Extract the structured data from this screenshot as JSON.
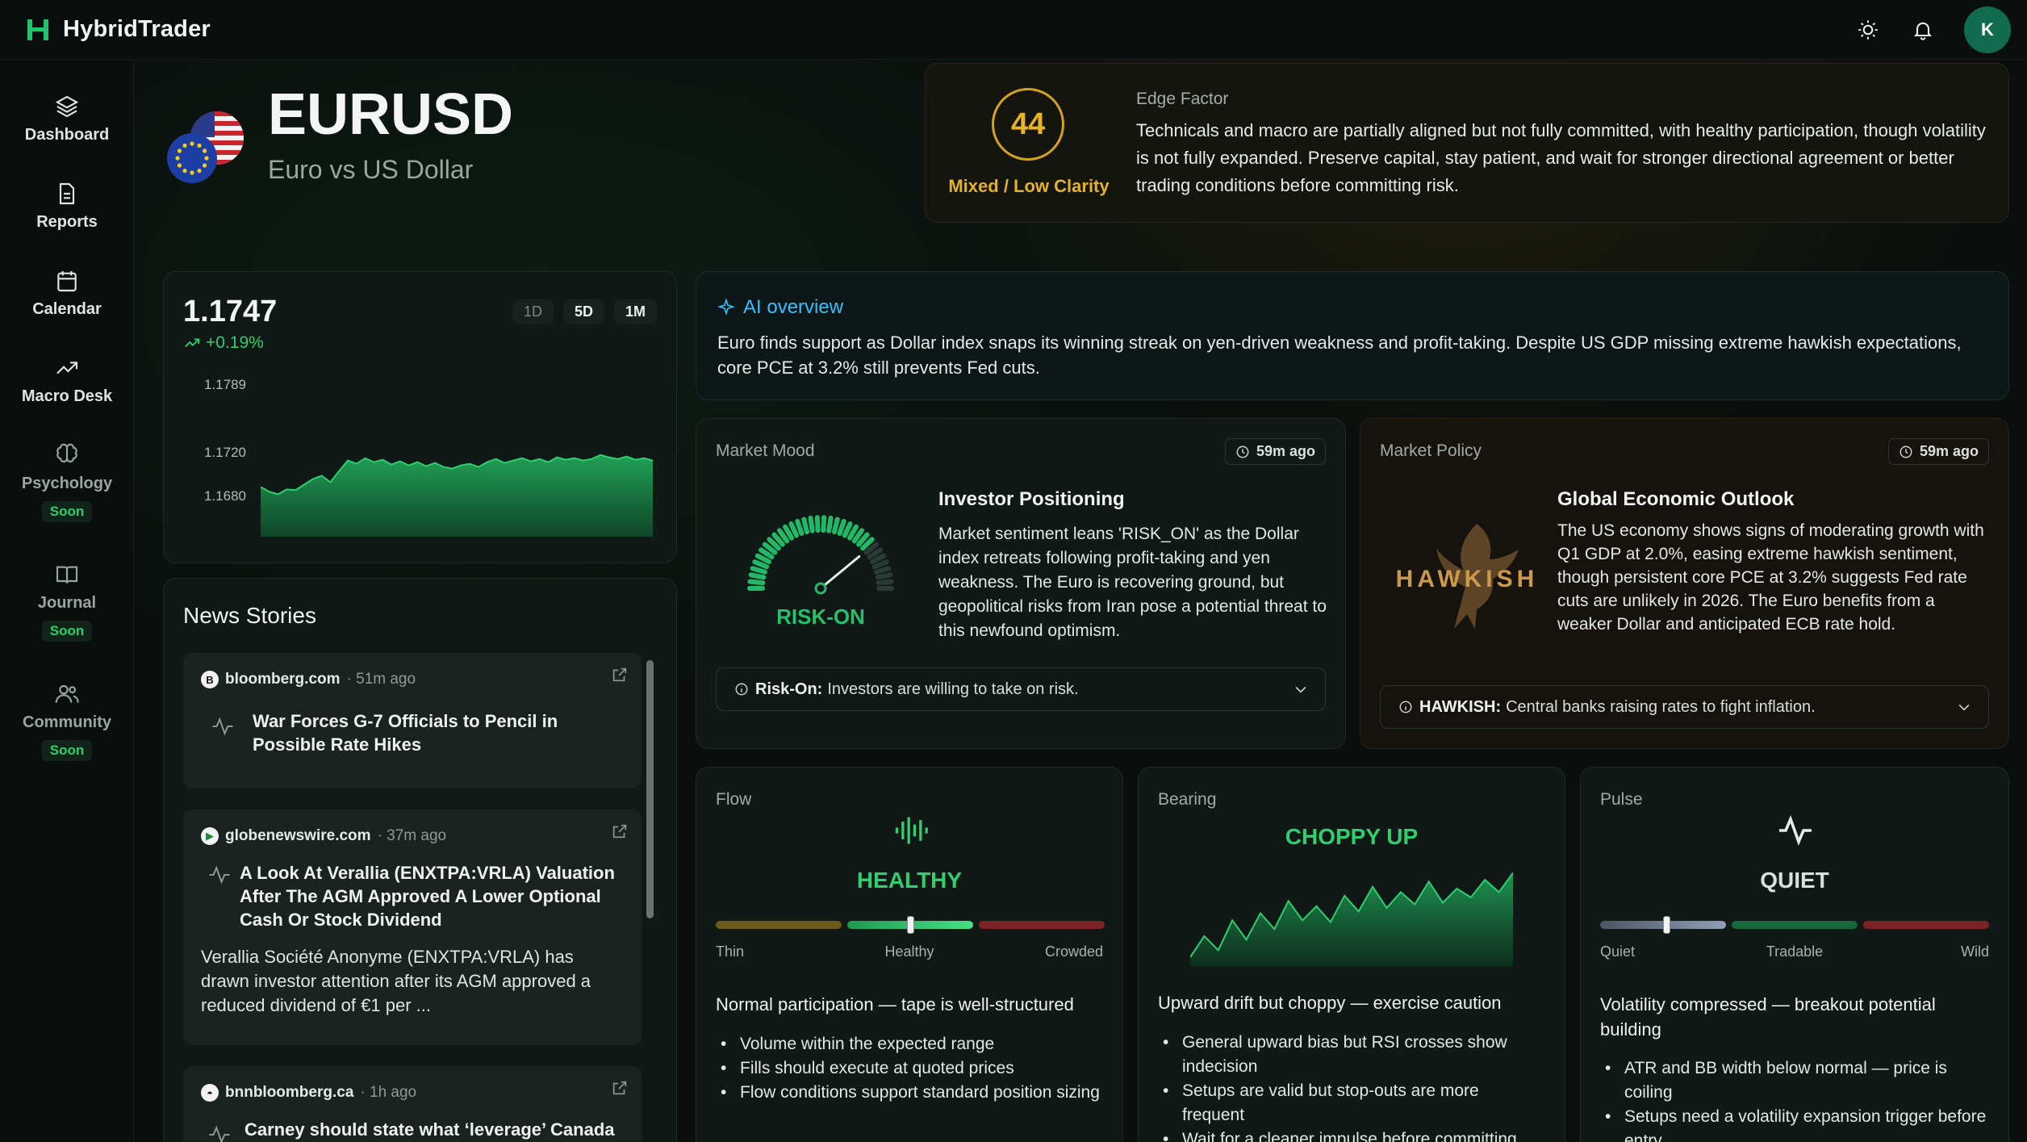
{
  "app": {
    "name": "HybridTrader",
    "avatar_initial": "K"
  },
  "sidebar": {
    "items": [
      {
        "label": "Dashboard",
        "icon": "layers-icon"
      },
      {
        "label": "Reports",
        "icon": "document-icon"
      },
      {
        "label": "Calendar",
        "icon": "calendar-icon"
      },
      {
        "label": "Macro Desk",
        "icon": "trend-up-icon"
      },
      {
        "label": "Psychology",
        "icon": "brain-icon",
        "badge": "Soon"
      },
      {
        "label": "Journal",
        "icon": "book-icon",
        "badge": "Soon"
      },
      {
        "label": "Community",
        "icon": "users-icon",
        "badge": "Soon"
      }
    ]
  },
  "pair": {
    "symbol": "EURUSD",
    "name": "Euro vs US Dollar"
  },
  "edge": {
    "score": "44",
    "clarity": "Mixed / Low Clarity",
    "title": "Edge Factor",
    "text": "Technicals and macro are partially aligned but not fully committed, with healthy participation, though volatility is not fully expanded. Preserve capital, stay patient, and wait for stronger directional agreement or better trading conditions before committing risk.",
    "color": "#e4b224"
  },
  "price": {
    "value": "1.1747",
    "change": "+0.19%",
    "ranges": [
      "1D",
      "5D",
      "1M"
    ],
    "active_range": "1M",
    "y_ticks": [
      "1.1789",
      "1.1720",
      "1.1680"
    ],
    "chart_data": {
      "type": "area",
      "ylim": [
        1.164,
        1.1789
      ],
      "values": [
        1.1702,
        1.1696,
        1.1693,
        1.1699,
        1.1698,
        1.1705,
        1.1712,
        1.1716,
        1.1708,
        1.1722,
        1.1735,
        1.1731,
        1.1738,
        1.1733,
        1.1736,
        1.173,
        1.1734,
        1.1729,
        1.1733,
        1.1728,
        1.1732,
        1.1727,
        1.1725,
        1.1729,
        1.1731,
        1.1727,
        1.1733,
        1.1737,
        1.1732,
        1.1735,
        1.1738,
        1.1734,
        1.1737,
        1.1733,
        1.1739,
        1.1736,
        1.1738,
        1.1735,
        1.1737,
        1.1742,
        1.1739,
        1.1737,
        1.174,
        1.1736,
        1.1738,
        1.1735
      ],
      "color": "#2fce6f"
    }
  },
  "news": {
    "title": "News Stories",
    "items": [
      {
        "source": "bloomberg.com",
        "time": "51m ago",
        "headline": [
          "War Forces G-7 Officials to Pencil in",
          "Possible Rate Hikes"
        ],
        "description": []
      },
      {
        "source": "globenewswire.com",
        "time": "37m ago",
        "headline": [
          "A Look At Verallia (ENXTPA:VRLA) Valuation",
          "After The AGM Approved A Lower Optional",
          "Cash Or Stock Dividend"
        ],
        "description": [
          "Verallia Société Anonyme (ENXTPA:VRLA) has",
          "drawn investor attention after its AGM approved a",
          "reduced dividend of €1 per ..."
        ]
      },
      {
        "source": "bnnbloomberg.ca",
        "time": "1h ago",
        "headline": [
          "Carney should state what ‘leverage’ Canada"
        ],
        "description": []
      }
    ]
  },
  "ai": {
    "title": "AI overview",
    "text": "Euro finds support as Dollar index snaps its winning streak on yen-driven weakness and profit-taking. Despite US GDP missing extreme hawkish expectations, core PCE at 3.2% still prevents Fed cuts."
  },
  "mood": {
    "label": "Market Mood",
    "time": "59m ago",
    "state": "RISK-ON",
    "title": "Investor Positioning",
    "text": "Market sentiment leans 'RISK_ON' as the Dollar index retreats following profit-taking and yen weakness. The Euro is recovering ground, but geopolitical risks from Iran pose a potential threat to this newfound optimism.",
    "info_label": "Risk-On:",
    "info_text": "Investors are willing to take on risk.",
    "gauge_level": 0.78
  },
  "policy": {
    "label": "Market Policy",
    "time": "59m ago",
    "state": "HAWKISH",
    "title": "Global Economic Outlook",
    "text": "The US economy shows signs of moderating growth with Q1 GDP at 2.0%, easing extreme hawkish sentiment, though persistent core PCE at 3.2% suggests Fed rate cuts are unlikely in 2026. The Euro benefits from a weaker Dollar and anticipated ECB rate hold.",
    "info_label": "HAWKISH:",
    "info_text": "Central banks raising rates to fight inflation."
  },
  "flow": {
    "label": "Flow",
    "state": "HEALTHY",
    "scale": [
      "Thin",
      "Healthy",
      "Crowded"
    ],
    "level": 0.5,
    "summary": "Normal participation — tape is well-structured",
    "bullets": [
      "Volume within the expected range",
      "Fills should execute at quoted prices",
      "Flow conditions support standard position sizing"
    ]
  },
  "bearing": {
    "label": "Bearing",
    "state": "CHOPPY UP",
    "summary": "Upward drift but choppy — exercise caution",
    "bullets": [
      "General upward bias but RSI crosses show indecision",
      "Setups are valid but stop-outs are more frequent",
      "Wait for a cleaner impulse before committing"
    ],
    "spark": [
      10,
      34,
      18,
      52,
      30,
      60,
      42,
      74,
      52,
      68,
      50,
      80,
      62,
      90,
      66,
      84,
      70,
      96,
      72,
      88,
      78,
      98,
      84,
      106
    ]
  },
  "pulse": {
    "label": "Pulse",
    "state": "QUIET",
    "scale": [
      "Quiet",
      "Tradable",
      "Wild"
    ],
    "level": 0.17,
    "summary": "Volatility compressed — breakout potential building",
    "bullets": [
      "ATR and BB width below normal — price is coiling",
      "Setups need a volatility expansion trigger before entry"
    ]
  }
}
